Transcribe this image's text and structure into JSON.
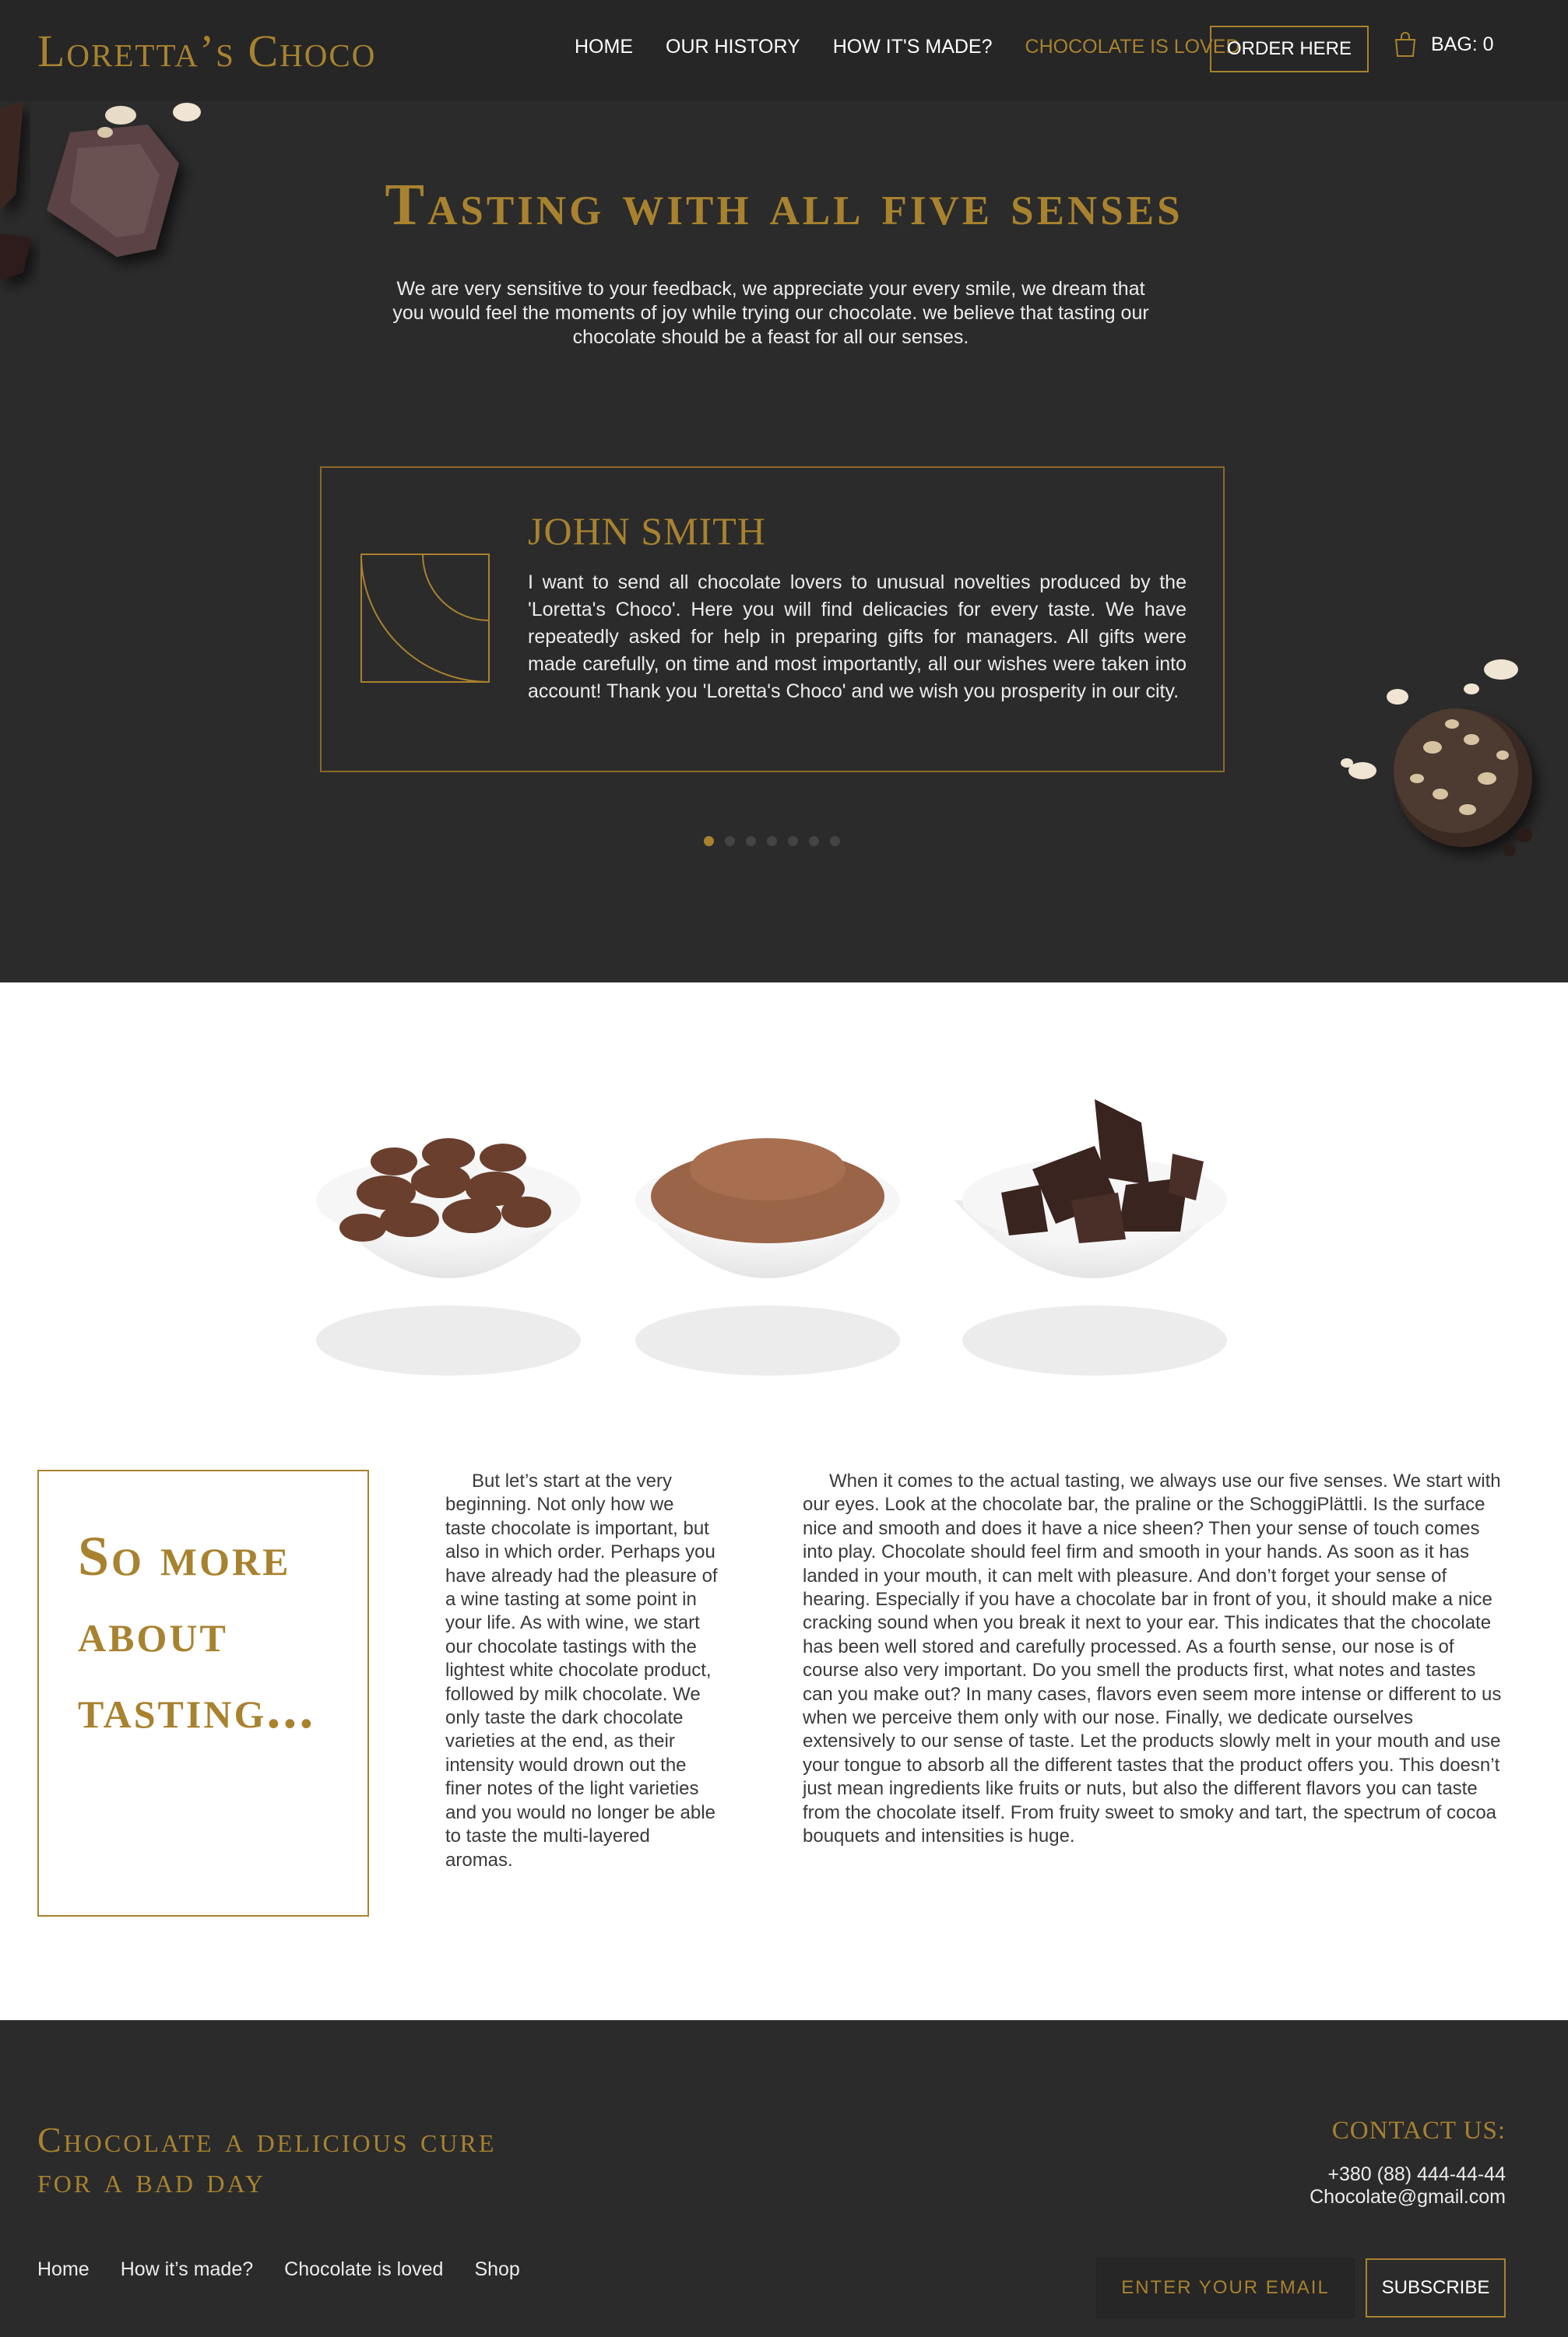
{
  "brand": {
    "logo": "Loretta’s Choco",
    "gold": "#a8822f",
    "dark": "#2b2b2b"
  },
  "nav": {
    "items": [
      {
        "label": "HOME"
      },
      {
        "label": "OUR HISTORY"
      },
      {
        "label": "HOW IT'S MADE?"
      },
      {
        "label": "CHOCOLATE IS LOVED"
      }
    ],
    "active": "CHOCOLATE IS LOVED",
    "order_label": "ORDER HERE",
    "bag_label": "BAG: 0",
    "bag_icon": "shopping-bag-icon"
  },
  "hero": {
    "title": "Tasting with all five senses",
    "description": "We are very sensitive to your feedback, we appreciate your every smile, we dream that you would feel the moments of joy while trying our chocolate. we believe that tasting our chocolate should be a feast for all our senses."
  },
  "testimonial": {
    "name": "JOHN SMITH",
    "text": "I want to send all chocolate lovers to unusual novelties produced by the 'Loretta's Choco'. Here you will find delicacies for every taste. We have repeatedly asked for help in preparing gifts for managers. All gifts were made carefully, on time and most importantly, all our wishes were taken into account! Thank you 'Loretta's Choco' and we wish you prosperity in our city.",
    "slides_total": 7,
    "active_slide": 1
  },
  "tasting": {
    "title": "So more about tasting...",
    "col1": "But let’s start at the very beginning. Not only how we taste chocolate is important, but also in which order. Perhaps you have already had the pleasure of a wine tasting at some point in your life. As with wine, we start our chocolate tastings with the lightest white chocolate product, followed by milk chocolate. We only taste the dark chocolate varieties at the end, as their intensity would drown out the finer notes of the light varieties and you would no longer be able to taste the multi-layered aromas.",
    "col2": "When it comes to the actual tasting, we always use our five senses. We start with our eyes. Look at the chocolate bar, the praline or the SchoggiPlättli. Is the surface nice and smooth and does it have a nice sheen? Then your sense of touch comes into play. Chocolate should feel firm and smooth in your hands. As soon as it has landed in your mouth, it can melt with pleasure. And don’t forget your sense of hearing. Especially if you have a chocolate bar in front of you, it should make a nice cracking sound when you break it next to your ear. This indicates that the chocolate has been well stored and carefully processed. As a fourth sense, our nose is of course also very important. Do you smell the products first, what notes and tastes can you make out? In many cases, flavors even seem more intense or different to us when we perceive them only with our nose. Finally, we dedicate ourselves extensively to our sense of taste. Let the products slowly melt in your mouth and use your tongue to absorb all the different tastes that the product offers you. This doesn’t just mean ingredients like fruits or nuts, but also the different flavors you can taste from the chocolate itself. From fruity sweet to smoky and tart, the spectrum of cocoa bouquets and intensities is huge."
  },
  "footer": {
    "tagline": "Chocolate a delicious cure for a bad day",
    "links": [
      {
        "label": "Home"
      },
      {
        "label": "How it’s made?"
      },
      {
        "label": "Chocolate is loved"
      },
      {
        "label": "Shop"
      }
    ],
    "contact_title": "CONTACT US:",
    "phone": "+380 (88) 444-44-44",
    "email": "Chocolate@gmail.com",
    "email_placeholder": "ENTER YOUR EMAIL",
    "subscribe_label": "SUBSCRIBE"
  }
}
